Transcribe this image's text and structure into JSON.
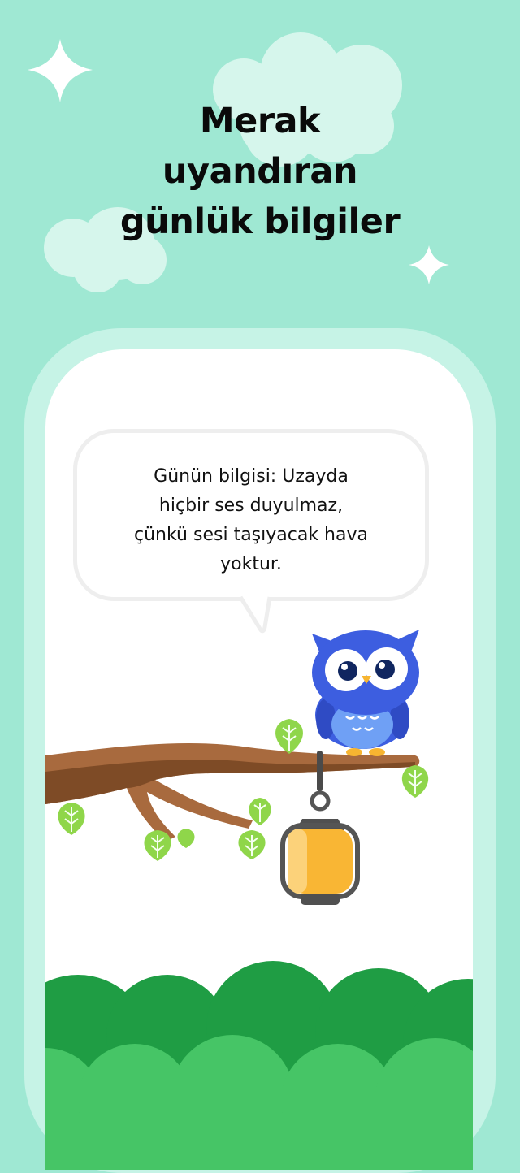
{
  "headline": {
    "line1": "Merak",
    "line2": "uyandıran",
    "line3": "günlük bilgiler"
  },
  "fact_bubble": {
    "line1": "Günün bilgisi: Uzayda",
    "line2": "hiçbir ses duyulmaz,",
    "line3": "çünkü sesi taşıyacak hava",
    "line4": "yoktur."
  },
  "colors": {
    "background": "#9fe8d3",
    "frame": "#c6f3e6",
    "owl": "#3d5ee0",
    "branch": "#9b5a33",
    "leaf": "#8fd64a",
    "lantern": "#f9b634",
    "bushes": "#2fb24f"
  },
  "icons": [
    "sparkle-icon",
    "cloud-icon",
    "owl-mascot",
    "lantern-icon",
    "leaf-icon"
  ]
}
